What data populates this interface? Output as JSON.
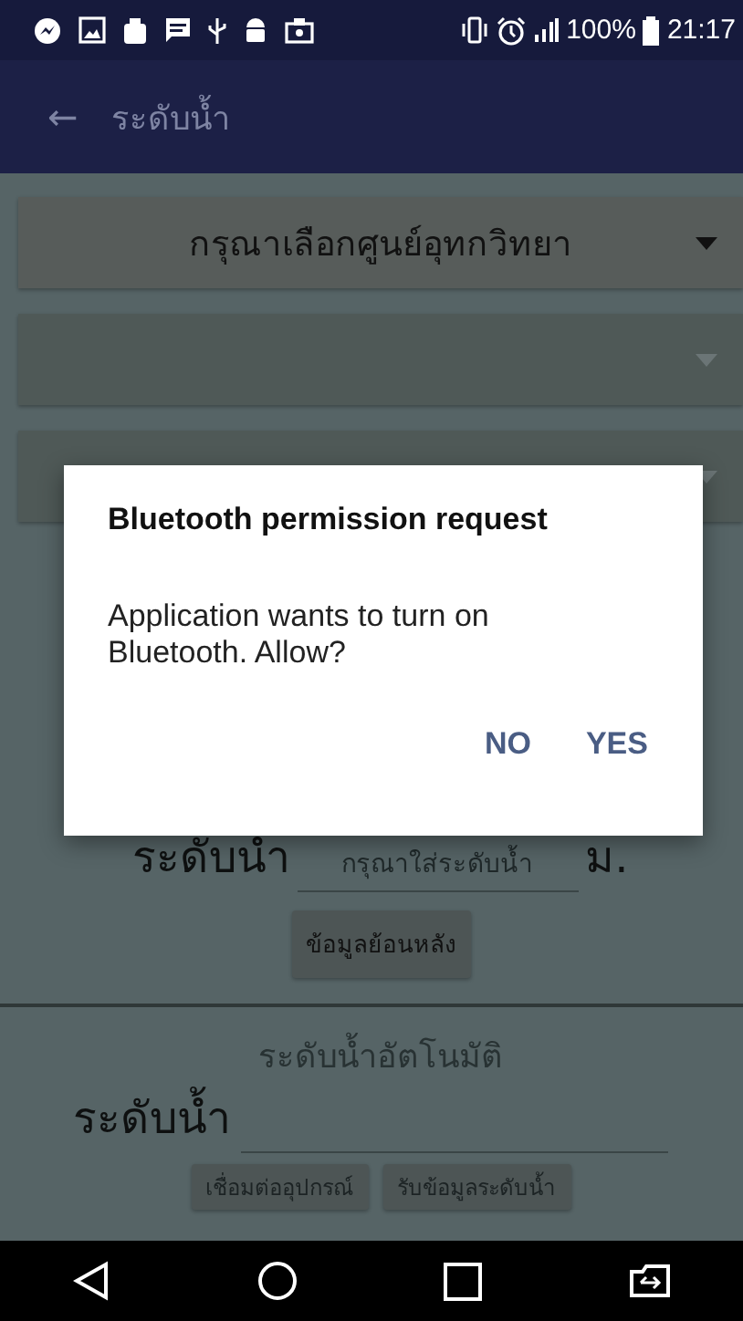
{
  "status_bar": {
    "battery": "100%",
    "time": "21:17"
  },
  "app_bar": {
    "back": "←",
    "title": "ระดับน้ำ"
  },
  "spinners": [
    {
      "text": "กรุณาเลือกศูนย์อุทกวิทยา",
      "enabled": true
    },
    {
      "enabled": false
    },
    {
      "enabled": false
    }
  ],
  "manual": {
    "label": "ระดับนำ",
    "placeholder": "กรุณาใส่ระดับน้ำ",
    "unit": "ม.",
    "button": "ข้อมูลย้อนหลัง"
  },
  "auto": {
    "heading": "ระดับน้ำอัตโนมัติ",
    "label": "ระดับน้ำ",
    "buttons": [
      "เชื่อมต่ออุปกรณ์",
      "รับข้อมูลระดับน้ำ"
    ]
  },
  "dialog": {
    "title": "Bluetooth permission request",
    "message": "Application wants to turn on Bluetooth. Allow?",
    "buttons": [
      "NO",
      "YES"
    ]
  }
}
